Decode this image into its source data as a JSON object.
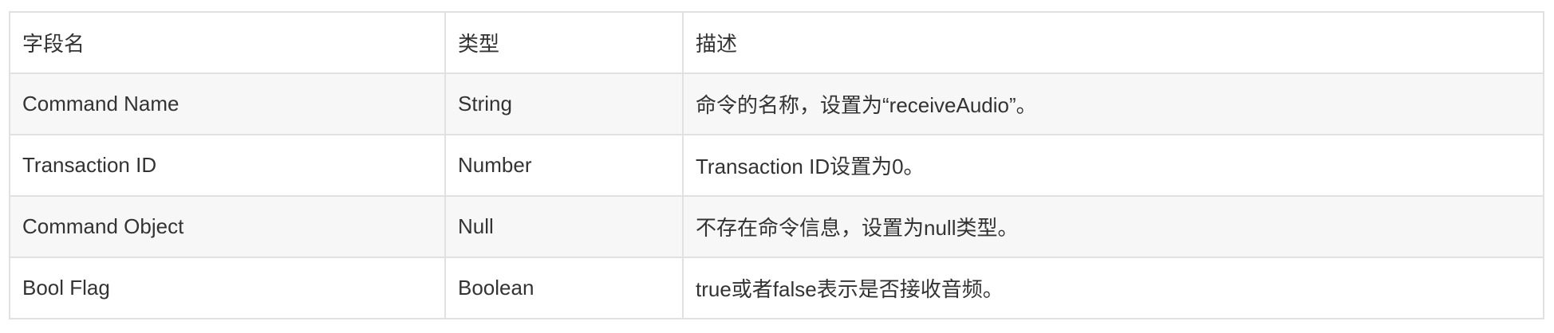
{
  "table": {
    "headers": [
      "字段名",
      "类型",
      "描述"
    ],
    "rows": [
      {
        "field": "Command Name",
        "type": "String",
        "desc": "命令的名称，设置为“receiveAudio”。"
      },
      {
        "field": "Transaction ID",
        "type": "Number",
        "desc": "Transaction ID设置为0。"
      },
      {
        "field": "Command Object",
        "type": "Null",
        "desc": "不存在命令信息，设置为null类型。"
      },
      {
        "field": "Bool Flag",
        "type": "Boolean",
        "desc": "true或者false表示是否接收音频。"
      }
    ]
  }
}
